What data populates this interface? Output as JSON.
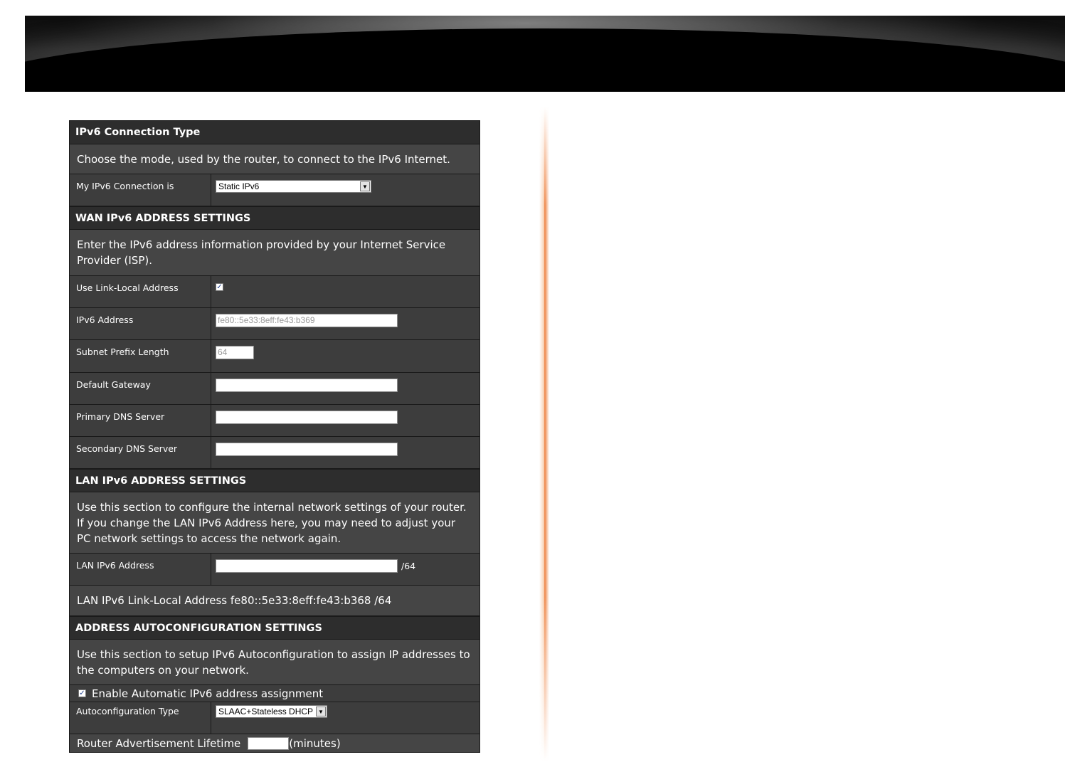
{
  "connection_type": {
    "title": "IPv6 Connection Type",
    "description": "Choose the mode, used by the router, to connect to the IPv6 Internet.",
    "label": "My IPv6 Connection is",
    "selected": "Static IPv6"
  },
  "wan": {
    "title": "WAN IPv6 ADDRESS SETTINGS",
    "description": "Enter the IPv6 address information provided by your Internet Service Provider (ISP).",
    "use_link_local_label": "Use Link-Local Address",
    "use_link_local_checked": true,
    "ipv6_address_label": "IPv6 Address",
    "ipv6_address_value": "fe80::5e33:8eff:fe43:b369",
    "prefix_label": "Subnet Prefix Length",
    "prefix_value": "64",
    "gateway_label": "Default Gateway",
    "gateway_value": "",
    "primary_dns_label": "Primary DNS Server",
    "primary_dns_value": "",
    "secondary_dns_label": "Secondary DNS Server",
    "secondary_dns_value": ""
  },
  "lan": {
    "title": "LAN IPv6 ADDRESS SETTINGS",
    "description": "Use this section to configure the internal network settings of your router. If you change the LAN IPv6 Address here, you may need to adjust your PC network settings to access the network again.",
    "address_label": "LAN IPv6 Address",
    "address_value": "",
    "address_suffix": "/64",
    "link_local_text": "LAN IPv6 Link-Local Address fe80::5e33:8eff:fe43:b368 /64"
  },
  "autoconfig": {
    "title": "ADDRESS AUTOCONFIGURATION SETTINGS",
    "description": "Use this section to setup IPv6 Autoconfiguration to assign IP addresses to the computers on your network.",
    "enable_label": "Enable Automatic IPv6 address assignment",
    "enable_checked": true,
    "type_label": "Autoconfiguration Type",
    "type_selected": "SLAAC+Stateless DHCP",
    "lifetime_label": "Router Advertisement Lifetime",
    "lifetime_value": "",
    "lifetime_unit": "(minutes)"
  },
  "icons": {
    "dropdown_arrow": "chevron-down-icon",
    "checkmark": "checkmark-icon"
  },
  "colors": {
    "panel_bg": "#3a3a3a",
    "header_bg": "#2d2d2d",
    "accent_divider": "#ec7832"
  }
}
